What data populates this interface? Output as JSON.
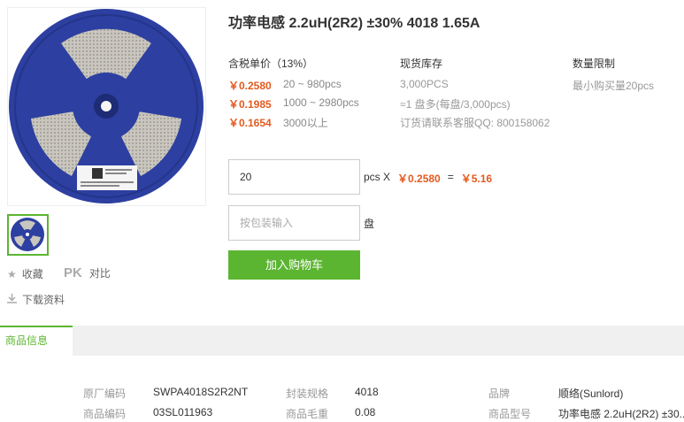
{
  "product": {
    "title": "功率电感 2.2uH(2R2) ±30% 4018 1.65A"
  },
  "gallery": {
    "main_image_icon": "component-reel-image",
    "thumbnail_icon": "component-reel-thumbnail"
  },
  "side_actions": {
    "favorite_label": "收藏",
    "pk_label": "PK",
    "compare_label": "对比",
    "download_label": "下载资料"
  },
  "pricing": {
    "header": "含税单价（13%）",
    "tiers": [
      {
        "price": "￥0.2580",
        "qty": "20 ~ 980pcs"
      },
      {
        "price": "￥0.1985",
        "qty": "1000 ~ 2980pcs"
      },
      {
        "price": "￥0.1654",
        "qty": "3000以上"
      }
    ]
  },
  "stock": {
    "header": "现货库存",
    "lines": [
      "3,000PCS",
      "≈1 盘多(每盘/3,000pcs)",
      "订货请联系客服QQ: 800158062"
    ]
  },
  "limit": {
    "header": "数量限制",
    "text": "最小购买量20pcs"
  },
  "order": {
    "quantity": "20",
    "unit_label": "pcs X",
    "unit_price": "￥0.2580",
    "equals": "=",
    "total": "￥5.16",
    "package_placeholder": "按包装输入",
    "package_unit": "盘",
    "add_to_cart_label": "加入购物车"
  },
  "tabs": {
    "active_label": "商品信息"
  },
  "specs": {
    "rows": [
      [
        {
          "label": "原厂编码",
          "value": "SWPA4018S2R2NT"
        },
        {
          "label": "封装规格",
          "value": "4018"
        },
        {
          "label": "品牌",
          "value": "顺络(Sunlord)"
        }
      ],
      [
        {
          "label": "商品编码",
          "value": "03SL011963"
        },
        {
          "label": "商品毛重",
          "value": "0.08"
        },
        {
          "label": "商品型号",
          "value": "功率电感 2.2uH(2R2) ±30.."
        }
      ]
    ]
  },
  "colors": {
    "accent_green": "#5cb531",
    "price_orange": "#e35a1f",
    "reel_blue": "#2d3fa0"
  }
}
